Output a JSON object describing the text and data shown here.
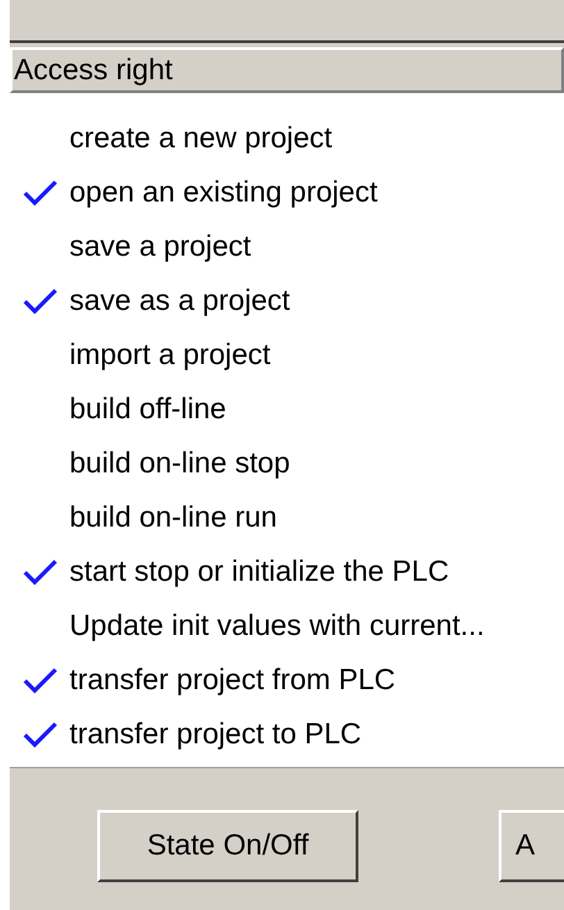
{
  "list": {
    "header": "Access right",
    "items": [
      {
        "label": "create a new project",
        "checked": false
      },
      {
        "label": "open an existing project",
        "checked": true
      },
      {
        "label": "save a project",
        "checked": false
      },
      {
        "label": "save as a project",
        "checked": true
      },
      {
        "label": "import a project",
        "checked": false
      },
      {
        "label": "build off-line",
        "checked": false
      },
      {
        "label": "build on-line stop",
        "checked": false
      },
      {
        "label": "build on-line run",
        "checked": false
      },
      {
        "label": "start stop or initialize the PLC",
        "checked": true
      },
      {
        "label": "Update init values with current...",
        "checked": false
      },
      {
        "label": "transfer project from PLC",
        "checked": true
      },
      {
        "label": "transfer project to PLC",
        "checked": true
      }
    ]
  },
  "buttons": [
    "State On/Off",
    "A"
  ]
}
